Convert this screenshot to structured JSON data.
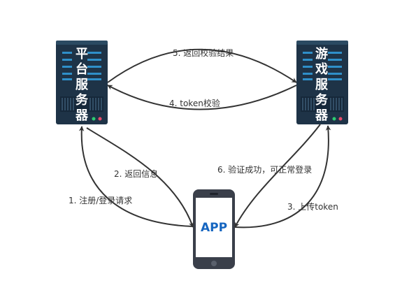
{
  "servers": {
    "platform": {
      "title_chars": [
        "平",
        "台",
        "服",
        "务",
        "器"
      ]
    },
    "game": {
      "title_chars": [
        "游",
        "戏",
        "服",
        "务",
        "器"
      ]
    }
  },
  "app": {
    "label": "APP"
  },
  "edges": [
    {
      "id": "e1",
      "label": "1. 注册/登录请求"
    },
    {
      "id": "e2",
      "label": "2. 返回信息"
    },
    {
      "id": "e3",
      "label": "3. 上传token"
    },
    {
      "id": "e4",
      "label": "4. token校验"
    },
    {
      "id": "e5",
      "label": "5. 返回校验结果"
    },
    {
      "id": "e6",
      "label": "6. 验证成功，可正常登录"
    }
  ],
  "colors": {
    "server_body": "#1e3347",
    "server_top": "#2b4a62",
    "server_stripe": "#2f8fc9",
    "led_green": "#2ecc71",
    "led_red": "#e84a6a",
    "phone_body": "#3a3f4a",
    "app_text": "#1565c0",
    "arrow": "#333333"
  }
}
